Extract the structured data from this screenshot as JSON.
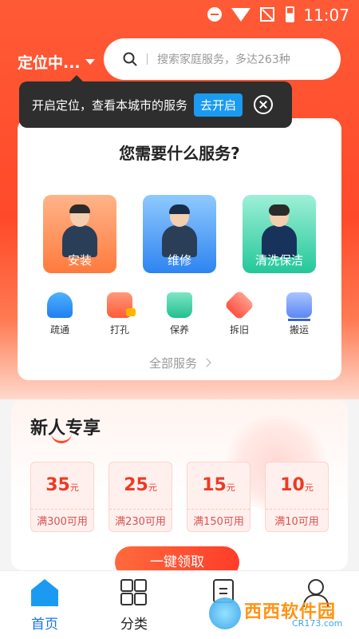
{
  "status_bar": {
    "time": "11:07"
  },
  "header": {
    "location_label": "定位中...",
    "search_placeholder": "搜索家庭服务，多达263种"
  },
  "location_tip": {
    "text": "开启定位，查看本城市的服务",
    "button_label": "去开启"
  },
  "services_card": {
    "title": "您需要什么服务?",
    "big_tiles": [
      {
        "label": "安装"
      },
      {
        "label": "维修"
      },
      {
        "label": "清洗保洁"
      }
    ],
    "small_items": [
      {
        "label": "疏通",
        "icon": "drain-icon"
      },
      {
        "label": "打孔",
        "icon": "drill-icon"
      },
      {
        "label": "保养",
        "icon": "maintenance-icon"
      },
      {
        "label": "拆旧",
        "icon": "demolish-icon"
      },
      {
        "label": "搬运",
        "icon": "cart-icon"
      }
    ],
    "all_services_label": "全部服务"
  },
  "promo": {
    "title": "新人专享",
    "coupons": [
      {
        "amount": "35",
        "unit": "元",
        "condition": "满300可用"
      },
      {
        "amount": "25",
        "unit": "元",
        "condition": "满230可用"
      },
      {
        "amount": "15",
        "unit": "元",
        "condition": "满150可用"
      },
      {
        "amount": "10",
        "unit": "元",
        "condition": "满10可用"
      }
    ],
    "claim_button_label": "一键领取"
  },
  "bottom_nav": {
    "items": [
      {
        "label": "首页",
        "active": true
      },
      {
        "label": "分类"
      },
      {
        "label": ""
      },
      {
        "label": ""
      }
    ]
  },
  "watermark": {
    "text": "西西软件园",
    "sub": "CR173.com"
  },
  "colors": {
    "brand_red": "#ff4a2a",
    "accent_blue": "#1b9af2",
    "coupon_red": "#ee3a23"
  }
}
